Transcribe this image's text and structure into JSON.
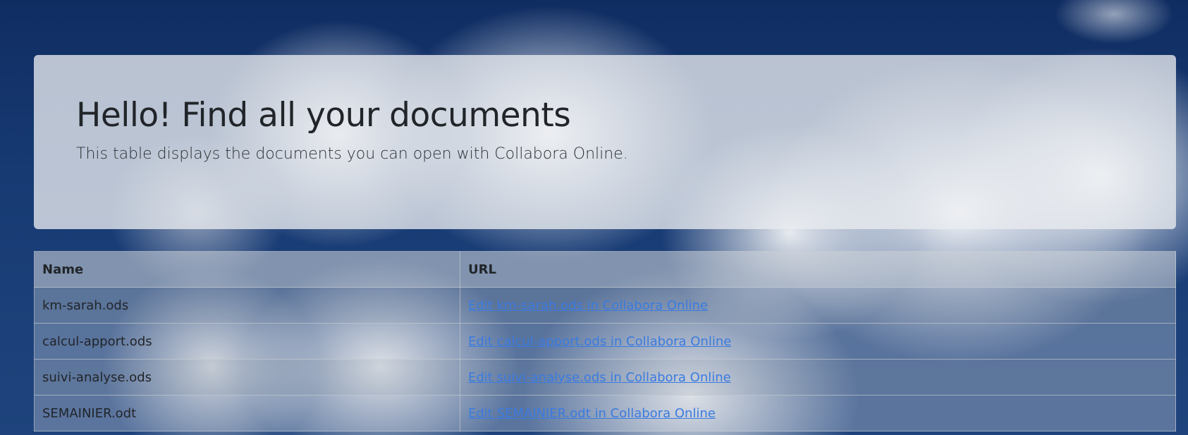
{
  "header": {
    "title": "Hello! Find all your documents",
    "subtitle": "This table displays the documents you can open with Collabora Online."
  },
  "table": {
    "columns": [
      "Name",
      "URL"
    ],
    "rows": [
      {
        "name": "km-sarah.ods",
        "link": "Edit km-sarah.ods in Collabora Online"
      },
      {
        "name": "calcul-apport.ods",
        "link": "Edit calcul-apport.ods in Collabora Online"
      },
      {
        "name": "suivi-analyse.ods",
        "link": "Edit suivi-analyse.ods in Collabora Online"
      },
      {
        "name": "SEMAINIER.odt",
        "link": "Edit SEMAINIER.odt in Collabora Online"
      }
    ]
  },
  "colors": {
    "background": "#163466",
    "link": "#3b7be0",
    "text": "#212529"
  }
}
